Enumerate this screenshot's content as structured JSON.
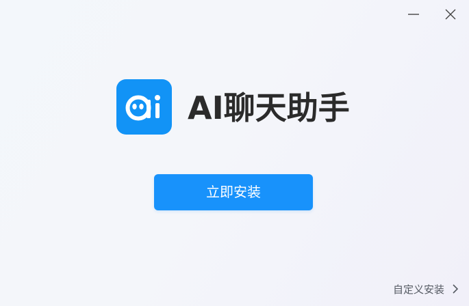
{
  "window": {
    "minimize_icon": "minimize-icon",
    "close_icon": "close-icon"
  },
  "app": {
    "logo_icon": "ai-chat-logo-icon",
    "title": "AI聊天助手"
  },
  "actions": {
    "install_label": "立即安装",
    "custom_install_label": "自定义安装",
    "custom_install_icon": "chevron-right-icon"
  },
  "colors": {
    "accent": "#1892fb",
    "logo_bg": "#1293f6",
    "title_text": "#2b2b2b",
    "link_text": "#555a62"
  }
}
